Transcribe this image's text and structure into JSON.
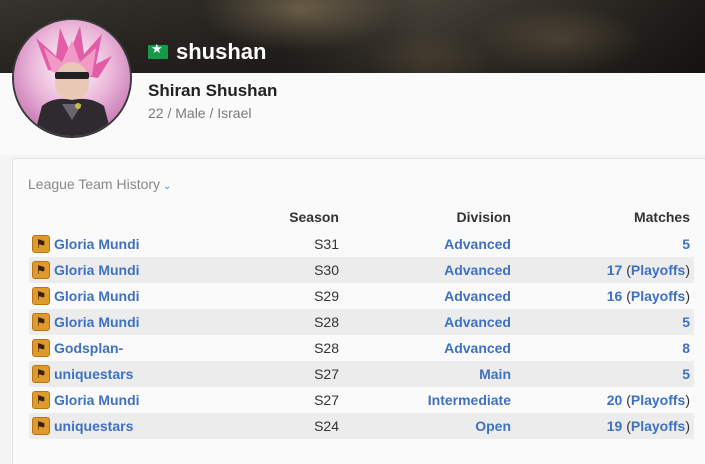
{
  "profile": {
    "nickname": "shushan",
    "real_name": "Shiran Shushan",
    "meta": "22 / Male / Israel",
    "flag_icon": "israel-flag-icon",
    "avatar_icon": "avatar-image"
  },
  "history": {
    "title": "League Team History",
    "headers": {
      "team": "",
      "season": "Season",
      "division": "Division",
      "matches": "Matches"
    },
    "rows": [
      {
        "team": "Gloria Mundi",
        "season": "S31",
        "division": "Advanced",
        "matches": "5",
        "playoffs": ""
      },
      {
        "team": "Gloria Mundi",
        "season": "S30",
        "division": "Advanced",
        "matches": "17",
        "playoffs": "Playoffs"
      },
      {
        "team": "Gloria Mundi",
        "season": "S29",
        "division": "Advanced",
        "matches": "16",
        "playoffs": "Playoffs"
      },
      {
        "team": "Gloria Mundi",
        "season": "S28",
        "division": "Advanced",
        "matches": "5",
        "playoffs": ""
      },
      {
        "team": "Godsplan-",
        "season": "S28",
        "division": "Advanced",
        "matches": "8",
        "playoffs": ""
      },
      {
        "team": "uniquestars",
        "season": "S27",
        "division": "Main",
        "matches": "5",
        "playoffs": ""
      },
      {
        "team": "Gloria Mundi",
        "season": "S27",
        "division": "Intermediate",
        "matches": "20",
        "playoffs": "Playoffs"
      },
      {
        "team": "uniquestars",
        "season": "S24",
        "division": "Open",
        "matches": "19",
        "playoffs": "Playoffs"
      }
    ],
    "game_icon": "counter-strike-icon"
  },
  "colors": {
    "link": "#3e71c2",
    "flag_green": "#149a49",
    "game_icon": "#e09a2c"
  }
}
